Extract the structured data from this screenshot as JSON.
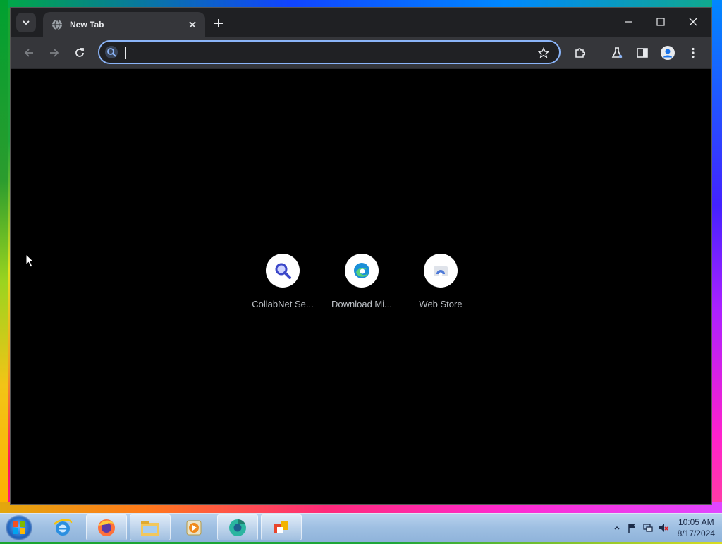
{
  "browser": {
    "tab": {
      "title": "New Tab"
    },
    "omnibox": {
      "value": "",
      "placeholder": ""
    },
    "accent": "#8ab4f8"
  },
  "shortcuts": [
    {
      "label": "CollabNet Se...",
      "icon": "collabnet-search-icon"
    },
    {
      "label": "Download Mi...",
      "icon": "microsoft-edge-icon"
    },
    {
      "label": "Web Store",
      "icon": "web-store-icon"
    }
  ],
  "taskbar": {
    "apps": [
      "internet-explorer-icon",
      "firefox-icon",
      "file-explorer-icon",
      "media-player-icon",
      "chrome-canary-icon",
      "office-icon"
    ],
    "clock": {
      "time": "10:05 AM",
      "date": "8/17/2024"
    }
  }
}
